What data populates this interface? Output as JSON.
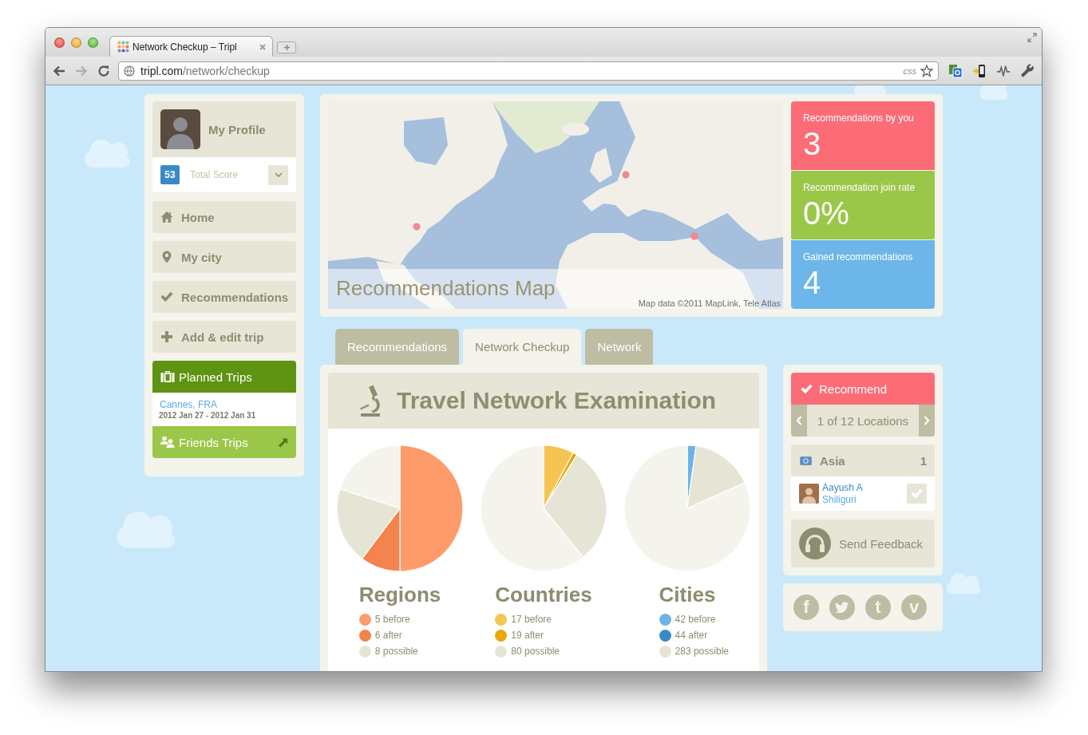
{
  "browser": {
    "tab_title": "Network Checkup – Tripl",
    "url_host": "tripl.com",
    "url_path": "/network/checkup",
    "address_badge": "css"
  },
  "profile": {
    "name": "My Profile",
    "score": "53",
    "score_label": "Total Score"
  },
  "nav": [
    {
      "label": "Home",
      "kind": "home"
    },
    {
      "label": "My city",
      "kind": "pin"
    },
    {
      "label": "Recommendations",
      "kind": "check"
    },
    {
      "label": "Add & edit trip",
      "kind": "plus"
    }
  ],
  "planned_trips": {
    "title": "Planned Trips",
    "trips": [
      {
        "place": "Cannes, FRA",
        "dates": "2012 Jan 27 - 2012 Jan 31"
      }
    ]
  },
  "friends_trips": {
    "title": "Friends Trips"
  },
  "map": {
    "title": "Recommendations Map",
    "attribution": "Map data ©2011 MapLink, Tele Atlas"
  },
  "stats": [
    {
      "label": "Recommendations by you",
      "value": "3",
      "color": "#fc6c76"
    },
    {
      "label": "Recommendation join rate",
      "value": "0%",
      "color": "#9bc748"
    },
    {
      "label": "Gained recommendations",
      "value": "4",
      "color": "#6cb6e9"
    }
  ],
  "tabs": [
    {
      "label": "Recommendations",
      "selected": false
    },
    {
      "label": "Network Checkup",
      "selected": true
    },
    {
      "label": "Network",
      "selected": false
    }
  ],
  "examination": {
    "title": "Travel Network Examination",
    "groups": [
      {
        "title": "Regions",
        "legend": [
          {
            "label": "5 before",
            "color": "#fe9b6b"
          },
          {
            "label": "6 after",
            "color": "#f4834d"
          },
          {
            "label": "8 possible",
            "color": "#e6e5d5"
          }
        ]
      },
      {
        "title": "Countries",
        "legend": [
          {
            "label": "17 before",
            "color": "#f6c451"
          },
          {
            "label": "19 after",
            "color": "#e9a800"
          },
          {
            "label": "80 possible",
            "color": "#e6e5d5"
          }
        ]
      },
      {
        "title": "Cities",
        "legend": [
          {
            "label": "42 before",
            "color": "#6cb4e6"
          },
          {
            "label": "44 after",
            "color": "#3a89c6"
          },
          {
            "label": "283 possible",
            "color": "#e6e5d5"
          }
        ]
      }
    ]
  },
  "recommend": {
    "title": "Recommend",
    "pager": "1 of 12 Locations",
    "region": {
      "name": "Asia",
      "count": "1"
    },
    "people": [
      {
        "name": "Aayush A",
        "city": "Shiliguri"
      }
    ]
  },
  "feedback": {
    "label": "Send Feedback"
  },
  "social": [
    {
      "kind": "letter",
      "glyph": "f"
    },
    {
      "kind": "bird"
    },
    {
      "kind": "letter",
      "glyph": "t"
    },
    {
      "kind": "letter",
      "glyph": "v"
    }
  ]
}
